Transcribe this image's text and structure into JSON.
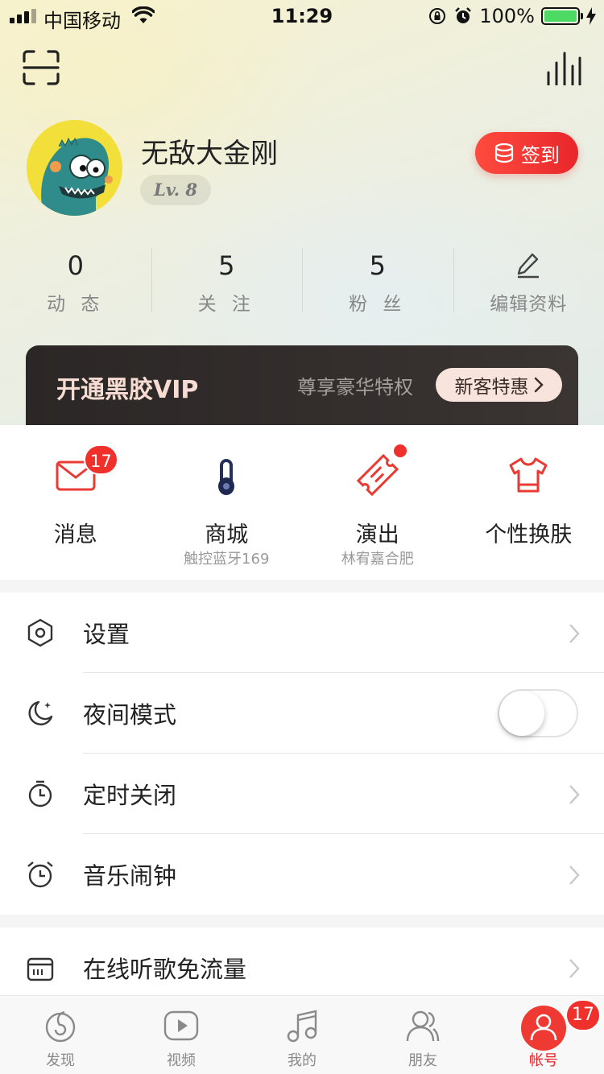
{
  "status_bar": {
    "carrier": "中国移动",
    "time": "11:29",
    "battery_percent": "100%",
    "battery_level": 1.0
  },
  "profile": {
    "nickname": "无敌大金刚",
    "level": "Lv. 8",
    "signin_label": "签到"
  },
  "stats": [
    {
      "value": "0",
      "label": "动 态"
    },
    {
      "value": "5",
      "label": "关 注"
    },
    {
      "value": "5",
      "label": "粉 丝"
    },
    {
      "value": "",
      "label": "编辑资料"
    }
  ],
  "vip": {
    "title": "开通黑胶VIP",
    "subtitle": "尊享豪华特权",
    "button": "新客特惠"
  },
  "quick": [
    {
      "title": "消息",
      "sub": "",
      "badge": "17",
      "icon": "mail-icon"
    },
    {
      "title": "商城",
      "sub": "触控蓝牙169",
      "badge": "",
      "icon": "headphones-icon"
    },
    {
      "title": "演出",
      "sub": "林宥嘉合肥",
      "badge": "",
      "icon": "ticket-icon"
    },
    {
      "title": "个性换肤",
      "sub": "",
      "badge": "",
      "icon": "tshirt-icon"
    }
  ],
  "settings": [
    {
      "label": "设置",
      "icon": "hexagon-settings-icon"
    },
    {
      "label": "夜间模式",
      "icon": "moon-icon",
      "toggle_on": false
    },
    {
      "label": "定时关闭",
      "icon": "timer-icon"
    },
    {
      "label": "音乐闹钟",
      "icon": "alarm-clock-icon"
    }
  ],
  "settings2": [
    {
      "label": "在线听歌免流量",
      "icon": "sim-card-icon"
    }
  ],
  "tabbar": {
    "items": [
      {
        "label": "发现",
        "icon": "discover-icon"
      },
      {
        "label": "视频",
        "icon": "video-icon"
      },
      {
        "label": "我的",
        "icon": "music-note-icon"
      },
      {
        "label": "朋友",
        "icon": "friends-icon"
      },
      {
        "label": "帐号",
        "icon": "account-icon",
        "badge": "17"
      }
    ],
    "active": "帐号"
  },
  "colors": {
    "brand_red": "#e8262b",
    "badge_red": "#f0302b",
    "vip_dark": "#2b2726",
    "battery_green": "#4cd964"
  }
}
